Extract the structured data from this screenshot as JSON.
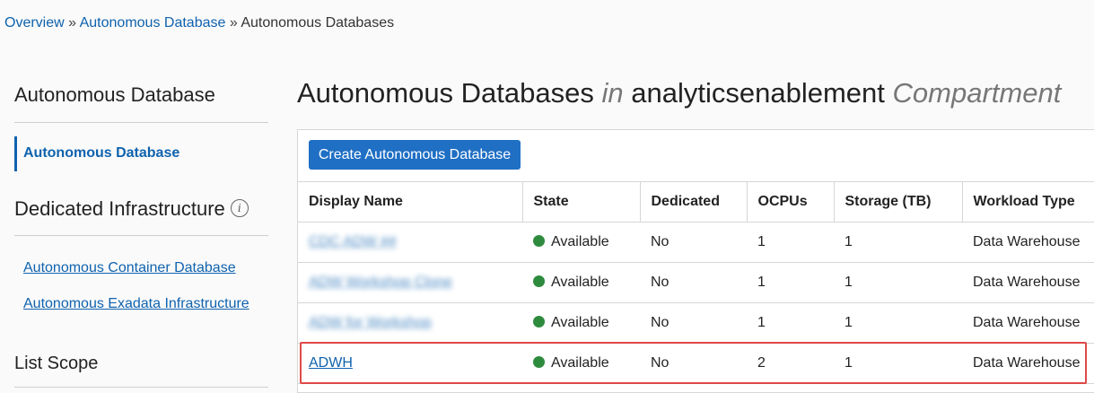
{
  "breadcrumb": {
    "items": [
      "Overview",
      "Autonomous Database",
      "Autonomous Databases"
    ],
    "separator": "»"
  },
  "sidebar": {
    "section1_title": "Autonomous Database",
    "active_item": "Autonomous Database",
    "section2_title": "Dedicated Infrastructure",
    "info_glyph": "i",
    "links": [
      "Autonomous Container Database",
      "Autonomous Exadata Infrastructure"
    ],
    "section3_title": "List Scope"
  },
  "page_title": {
    "prefix": "Autonomous Databases",
    "in": "in",
    "compartment_name": "analyticsenablement",
    "suffix": "Compartment"
  },
  "toolbar": {
    "create_label": "Create Autonomous Database"
  },
  "table": {
    "columns": [
      "Display Name",
      "State",
      "Dedicated",
      "OCPUs",
      "Storage (TB)",
      "Workload Type"
    ],
    "rows": [
      {
        "name": "CDC ADW ##",
        "state": "Available",
        "dedicated": "No",
        "ocpus": "1",
        "storage": "1",
        "workload": "Data Warehouse",
        "redacted": true
      },
      {
        "name": "ADW Workshop Clone",
        "state": "Available",
        "dedicated": "No",
        "ocpus": "1",
        "storage": "1",
        "workload": "Data Warehouse",
        "redacted": true
      },
      {
        "name": "ADW for Workshop",
        "state": "Available",
        "dedicated": "No",
        "ocpus": "1",
        "storage": "1",
        "workload": "Data Warehouse",
        "redacted": true
      },
      {
        "name": "ADWH",
        "state": "Available",
        "dedicated": "No",
        "ocpus": "2",
        "storage": "1",
        "workload": "Data Warehouse",
        "redacted": false
      }
    ]
  },
  "colors": {
    "link": "#0f62ae",
    "primary_button": "#1f6fc4",
    "status_available": "#2e8b3e",
    "highlight": "#e04848"
  }
}
